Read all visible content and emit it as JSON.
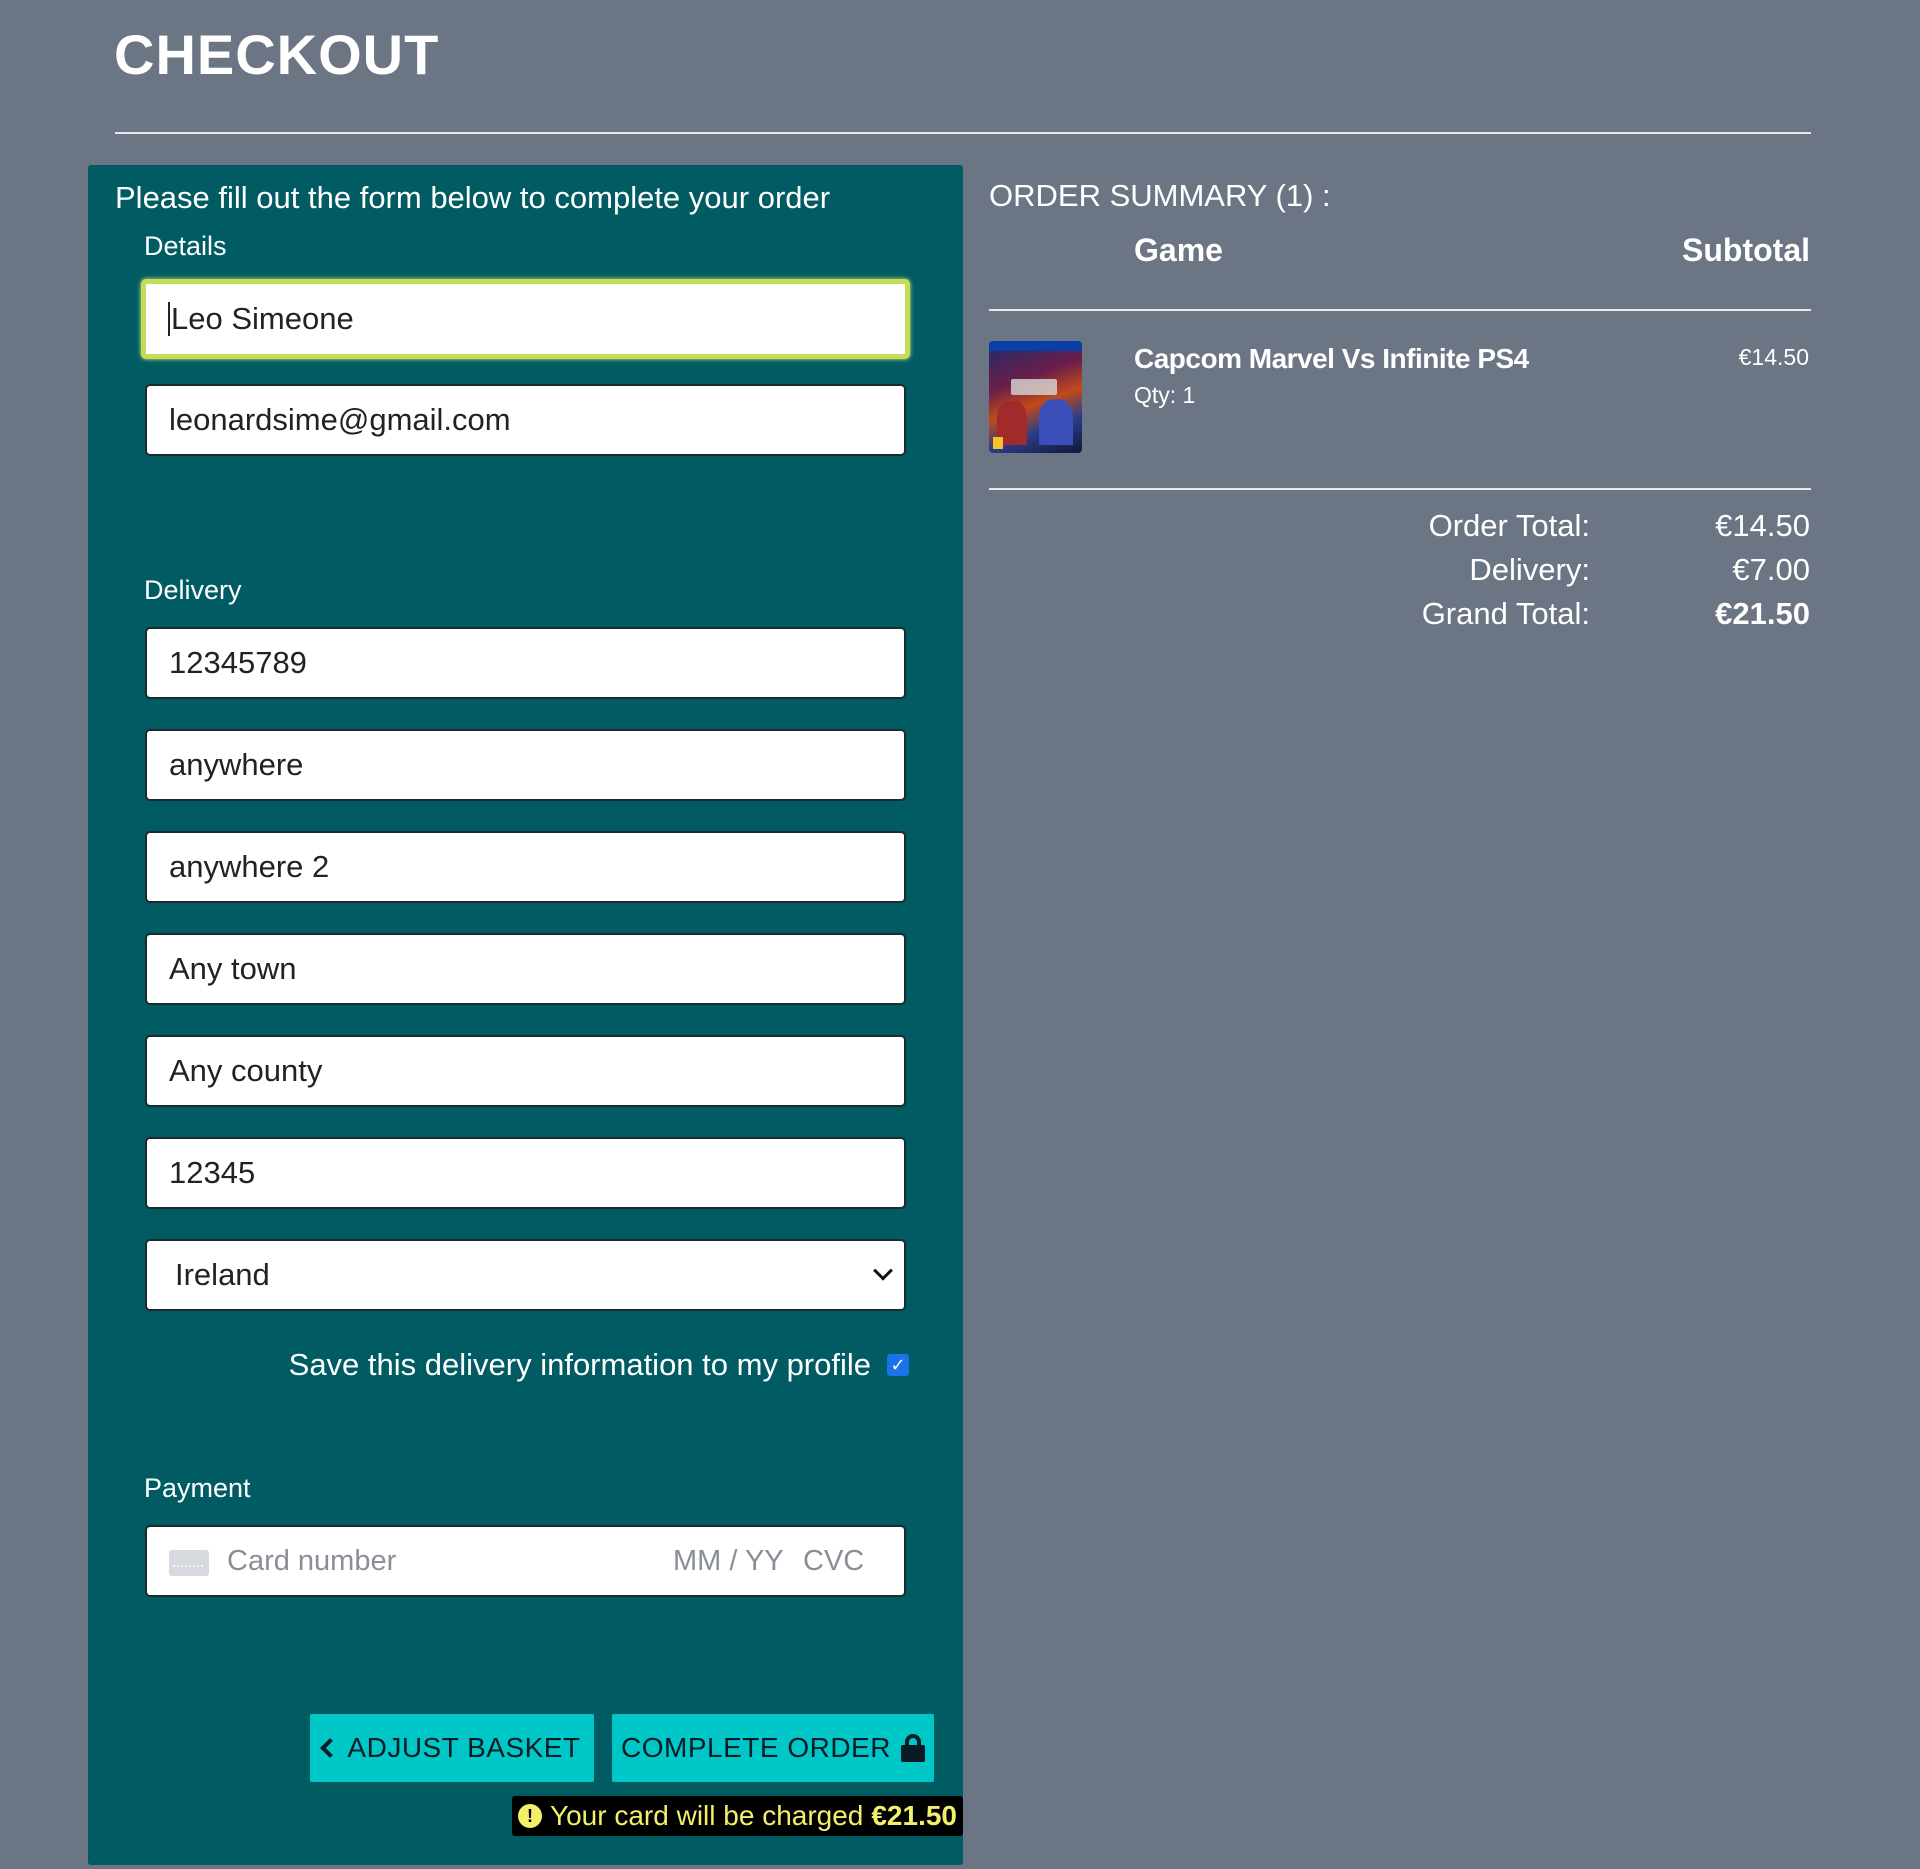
{
  "page": {
    "title": "CHECKOUT"
  },
  "form": {
    "intro": "Please fill out the form below to complete your order",
    "details": {
      "legend": "Details",
      "full_name": "Leo Simeone",
      "email": "leonardsime@gmail.com"
    },
    "delivery": {
      "legend": "Delivery",
      "phone": "12345789",
      "street_address1": "anywhere",
      "street_address2": "anywhere 2",
      "town": "Any town",
      "county": "Any county",
      "postcode": "12345",
      "country": "Ireland",
      "save_info_label": "Save this delivery information to my profile",
      "save_info_checked": true,
      "checkbox_mark": "✓"
    },
    "payment": {
      "legend": "Payment",
      "card_placeholder": "Card number",
      "expiry_placeholder": "MM / YY",
      "cvc_placeholder": "CVC"
    },
    "buttons": {
      "adjust_basket": "ADJUST BASKET",
      "complete_order": "COMPLETE ORDER"
    },
    "charge_note": {
      "icon": "!",
      "text": "Your card will be charged",
      "amount": "€21.50"
    }
  },
  "summary": {
    "title": "ORDER SUMMARY (1) :",
    "headers": {
      "game": "Game",
      "subtotal": "Subtotal"
    },
    "items": [
      {
        "name": "Capcom Marvel Vs Infinite PS4",
        "qty": "Qty: 1",
        "price": "€14.50"
      }
    ],
    "totals": {
      "order_total_label": "Order Total:",
      "order_total": "€14.50",
      "delivery_label": "Delivery:",
      "delivery": "€7.00",
      "grand_total_label": "Grand Total:",
      "grand_total": "€21.50"
    }
  },
  "colors": {
    "page_bg": "#6b7583",
    "panel_bg": "#005c62",
    "button_bg": "#00c7c7",
    "focus_ring": "#c5dd55",
    "note_text": "#f2f06b"
  }
}
